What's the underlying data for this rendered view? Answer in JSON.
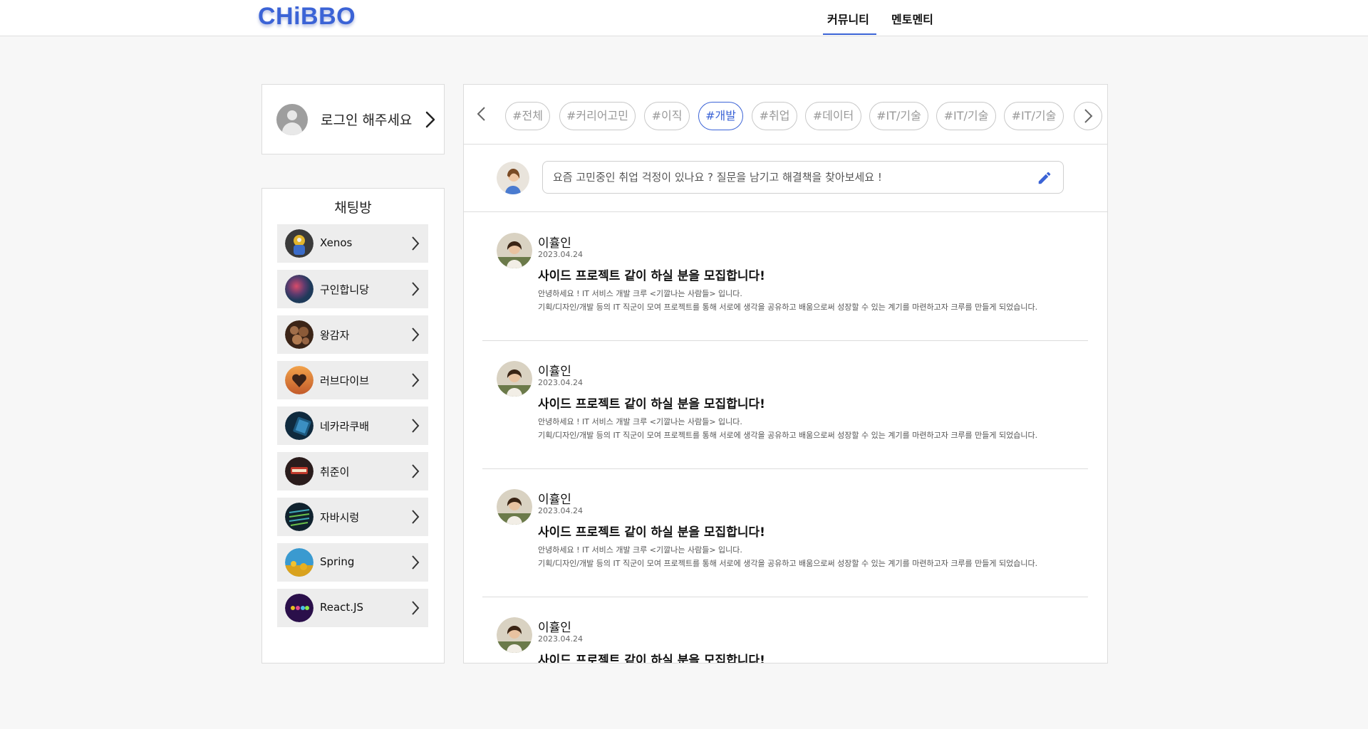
{
  "header": {
    "logo": "CHiBBO",
    "nav": [
      {
        "label": "커뮤니티",
        "active": true
      },
      {
        "label": "멘토멘티",
        "active": false
      }
    ],
    "accent_color": "#3b63d6"
  },
  "login": {
    "label": "로그인 해주세요",
    "avatar_icon": "user-placeholder-icon",
    "arrow_icon": "chevron-right-icon"
  },
  "chat": {
    "title": "채팅방",
    "rooms": [
      {
        "name": "Xenos"
      },
      {
        "name": "구인합니당"
      },
      {
        "name": "왕감자"
      },
      {
        "name": "러브다이브"
      },
      {
        "name": "네카라쿠배"
      },
      {
        "name": "취준이"
      },
      {
        "name": "자바시렁"
      },
      {
        "name": "Spring"
      },
      {
        "name": "React.JS"
      }
    ]
  },
  "tags": {
    "items": [
      {
        "label": "#전체",
        "active": false
      },
      {
        "label": "#커리어고민",
        "active": false
      },
      {
        "label": "#이직",
        "active": false
      },
      {
        "label": "#개발",
        "active": true
      },
      {
        "label": "#취업",
        "active": false
      },
      {
        "label": "#데이터",
        "active": false
      },
      {
        "label": "#IT/기술",
        "active": false
      },
      {
        "label": "#IT/기술",
        "active": false
      },
      {
        "label": "#IT/기술",
        "active": false
      }
    ],
    "prev_icon": "chevron-left-icon",
    "next_icon": "chevron-right-icon"
  },
  "compose": {
    "placeholder": "요즘 고민중인 취업 걱정이 있나요 ? 질문을 남기고 해결책을 찾아보세요 !",
    "edit_icon": "pencil-icon"
  },
  "posts": [
    {
      "author": "이휼인",
      "date": "2023.04.24",
      "title": "사이드 프로젝트 같이 하실 분을 모집합니다!",
      "body_line1": "안녕하세요 ! IT 서비스 개발 크루 <기깔나는 사람들> 입니다.",
      "body_line2": "기획/디자인/개발 등의 IT 직군이 모여 프로젝트를 통해 서로에 생각을 공유하고 배움으로써 성장할 수 있는 계기를 마련하고자 크루를 만들게 되었습니다."
    },
    {
      "author": "이휼인",
      "date": "2023.04.24",
      "title": "사이드 프로젝트 같이 하실 분을 모집합니다!",
      "body_line1": "안녕하세요 ! IT 서비스 개발 크루 <기깔나는 사람들> 입니다.",
      "body_line2": "기획/디자인/개발 등의 IT 직군이 모여 프로젝트를 통해 서로에 생각을 공유하고 배움으로써 성장할 수 있는 계기를 마련하고자 크루를 만들게 되었습니다."
    },
    {
      "author": "이휼인",
      "date": "2023.04.24",
      "title": "사이드 프로젝트 같이 하실 분을 모집합니다!",
      "body_line1": "안녕하세요 ! IT 서비스 개발 크루 <기깔나는 사람들> 입니다.",
      "body_line2": "기획/디자인/개발 등의 IT 직군이 모여 프로젝트를 통해 서로에 생각을 공유하고 배움으로써 성장할 수 있는 계기를 마련하고자 크루를 만들게 되었습니다."
    },
    {
      "author": "이휼인",
      "date": "2023.04.24",
      "title": "사이드 프로젝트 같이 하실 분을 모집합니다!",
      "body_line1": "",
      "body_line2": ""
    }
  ]
}
